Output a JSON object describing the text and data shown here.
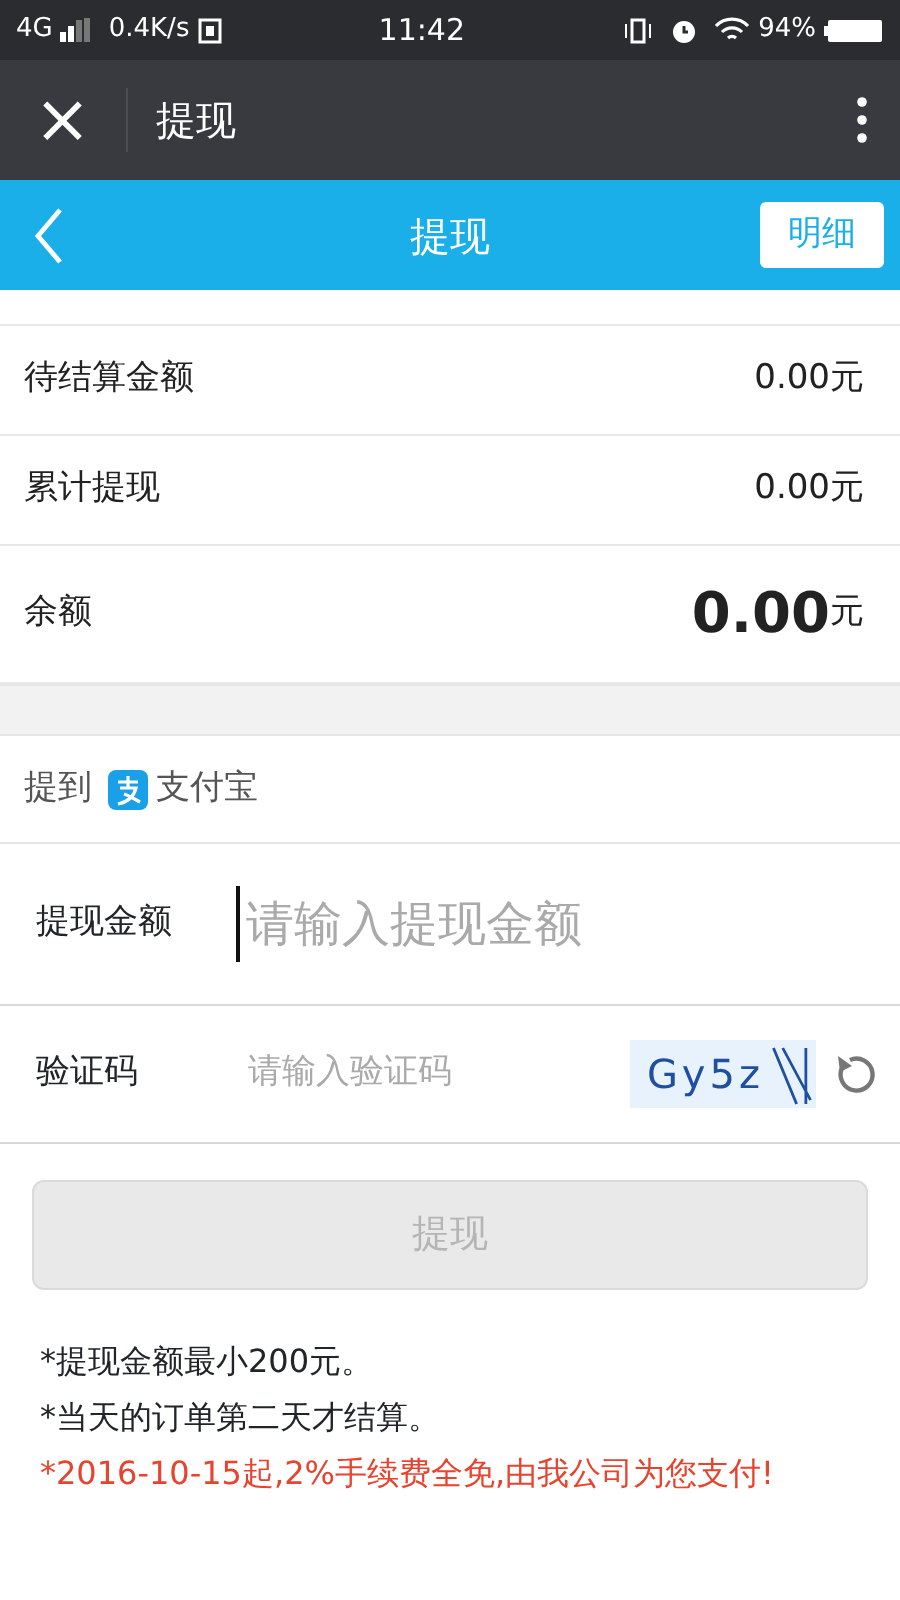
{
  "status_bar": {
    "network": "4G",
    "speed": "0.4K/s",
    "time": "11:42",
    "battery": "94%"
  },
  "app_bar": {
    "close": "×",
    "title": "提现"
  },
  "header": {
    "title": "提现",
    "detail_button": "明细"
  },
  "summary": [
    {
      "label": "待结算金额",
      "amount": "0.00",
      "unit": "元",
      "kind": "normal"
    },
    {
      "label": "累计提现",
      "amount": "0.00",
      "unit": "元",
      "kind": "normal"
    },
    {
      "label": "余额",
      "amount": "0.00",
      "unit": "元",
      "kind": "large"
    }
  ],
  "withdraw_to": {
    "label": "提到",
    "method": "支付宝"
  },
  "amount_field": {
    "label": "提现金额",
    "placeholder": "请输入提现金额"
  },
  "captcha_field": {
    "label": "验证码",
    "placeholder": "请输入验证码",
    "captcha": "Gy5z"
  },
  "submit": {
    "label": "提现",
    "disabled": true
  },
  "notes": [
    {
      "text": "*提现金额最小200元。",
      "kind": "plain"
    },
    {
      "text": "*当天的订单第二天才结算。",
      "kind": "plain"
    },
    {
      "text": "*2016-10-15起,2%手续费全免,由我公司为您支付!",
      "kind": "alert"
    }
  ]
}
